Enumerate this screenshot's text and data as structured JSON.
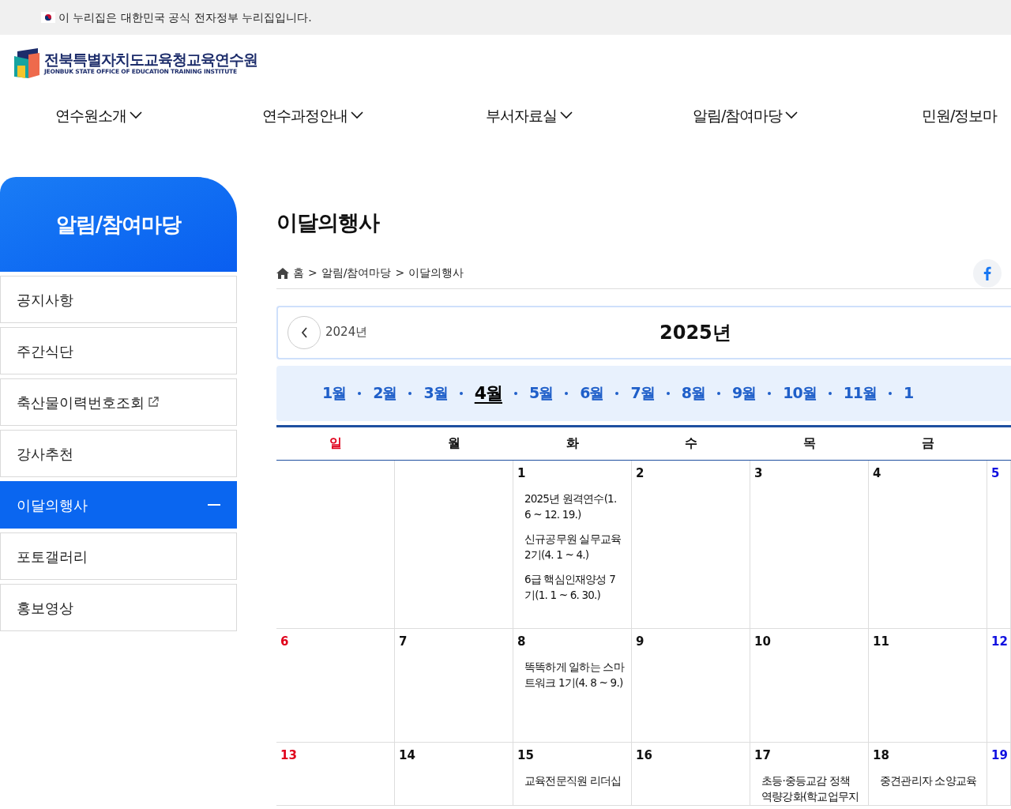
{
  "gov_banner": {
    "text": "이 누리집은 대한민국 공식 전자정부 누리집입니다."
  },
  "logo": {
    "title": "전북특별자치도교육청교육연수원",
    "subtitle": "JEONBUK STATE OFFICE OF EDUCATION TRAINING INSTITUTE"
  },
  "nav": [
    {
      "label": "연수원소개",
      "has_caret": true
    },
    {
      "label": "연수과정안내",
      "has_caret": true
    },
    {
      "label": "부서자료실",
      "has_caret": true
    },
    {
      "label": "알림/참여마당",
      "has_caret": true
    },
    {
      "label": "민원/정보마",
      "has_caret": false
    }
  ],
  "sidebar": {
    "title": "알림/참여마당",
    "items": [
      {
        "label": "공지사항",
        "selected": false,
        "external": false
      },
      {
        "label": "주간식단",
        "selected": false,
        "external": false
      },
      {
        "label": "축산물이력번호조회",
        "selected": false,
        "external": true
      },
      {
        "label": "강사추천",
        "selected": false,
        "external": false
      },
      {
        "label": "이달의행사",
        "selected": true,
        "external": false
      },
      {
        "label": "포토갤러리",
        "selected": false,
        "external": false
      },
      {
        "label": "홍보영상",
        "selected": false,
        "external": false
      }
    ]
  },
  "page_title": "이달의행사",
  "breadcrumb": [
    {
      "label": "홈"
    },
    {
      "separator": ">",
      "label": "알림/참여마당"
    },
    {
      "separator": ">",
      "label": "이달의행사"
    }
  ],
  "year_nav": {
    "prev": "2024년",
    "current": "2025년"
  },
  "months": [
    {
      "label": "1월",
      "selected": false
    },
    {
      "label": "2월",
      "selected": false
    },
    {
      "label": "3월",
      "selected": false
    },
    {
      "label": "4월",
      "selected": true
    },
    {
      "label": "5월",
      "selected": false
    },
    {
      "label": "6월",
      "selected": false
    },
    {
      "label": "7월",
      "selected": false
    },
    {
      "label": "8월",
      "selected": false
    },
    {
      "label": "9월",
      "selected": false
    },
    {
      "label": "10월",
      "selected": false
    },
    {
      "label": "11월",
      "selected": false
    },
    {
      "label": "1",
      "selected": false
    }
  ],
  "weekdays": [
    "일",
    "월",
    "화",
    "수",
    "목",
    "금"
  ],
  "weeks": [
    [
      {
        "day": "1",
        "events": [
          "2025년 원격연수(1. 6 ~ 12. 19.)",
          "신규공무원 실무교육 2기(4. 1 ~ 4.)",
          "6급 핵심인재양성 7기(1. 1 ~ 6. 30.)"
        ]
      },
      {
        "day": "2"
      },
      {
        "day": "3"
      },
      {
        "day": "4"
      },
      {
        "day": "5"
      }
    ],
    [
      {
        "day": "6"
      },
      {
        "day": "7"
      },
      {
        "day": "8",
        "events": [
          "똑똑하게 일하는 스마트워크 1기(4. 8 ~ 9.)"
        ]
      },
      {
        "day": "9"
      },
      {
        "day": "10"
      },
      {
        "day": "11"
      },
      {
        "day": "12"
      }
    ],
    [
      {
        "day": "13"
      },
      {
        "day": "14"
      },
      {
        "day": "15",
        "events": [
          "교육전문직원 리더십"
        ]
      },
      {
        "day": "16"
      },
      {
        "day": "17",
        "events": [
          "초등·중등교감 정책 역량강화(학교업무지"
        ]
      },
      {
        "day": "18",
        "events": [
          "중견관리자 소양교육"
        ]
      },
      {
        "day": "19"
      }
    ]
  ]
}
